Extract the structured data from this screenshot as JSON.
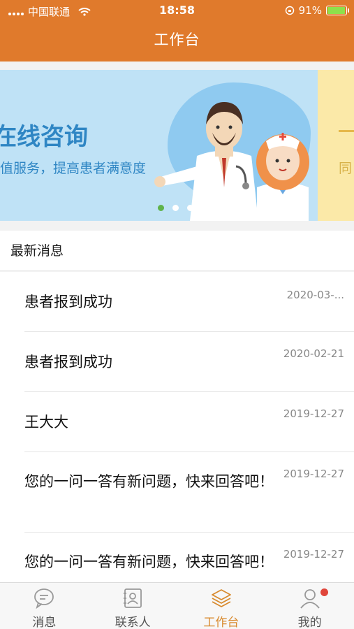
{
  "status_bar": {
    "carrier": "中国联通",
    "time": "18:58",
    "battery": "91%"
  },
  "nav": {
    "title": "工作台"
  },
  "banner": {
    "title": "在线咨询",
    "subtitle": "值服务，提高患者满意度",
    "next_text": "同",
    "active_dot": 0,
    "dot_count": 3
  },
  "messages": {
    "header": "最新消息",
    "items": [
      {
        "title": "患者报到成功",
        "date": "2020-03-..."
      },
      {
        "title": "患者报到成功",
        "date": "2020-02-21"
      },
      {
        "title": "王大大",
        "date": "2019-12-27"
      },
      {
        "title": "您的一问一答有新问题，快来回答吧！",
        "date": "2019-12-27"
      },
      {
        "title": "您的一问一答有新问题，快来回答吧！",
        "date": "2019-12-27"
      }
    ]
  },
  "tabs": [
    {
      "label": "消息",
      "icon": "chat-icon"
    },
    {
      "label": "联系人",
      "icon": "contacts-icon"
    },
    {
      "label": "工作台",
      "icon": "layers-icon"
    },
    {
      "label": "我的",
      "icon": "user-icon"
    }
  ],
  "colors": {
    "brand": "#e07a2c",
    "banner_bg": "#bfe2f6",
    "banner_text": "#2f86c4",
    "active_tab": "#d88a2e",
    "badge": "#e0453a"
  }
}
